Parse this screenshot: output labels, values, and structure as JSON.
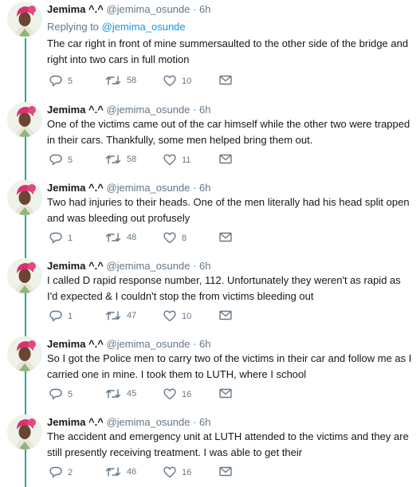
{
  "tweets": [
    {
      "name": "Jemima ^.^",
      "handle": "@jemima_osunde",
      "dot": "·",
      "time": "6h",
      "replying_prefix": "Replying to ",
      "replying_to": "@jemima_osunde",
      "text": "The car right in front of mine summersaulted to the other side of the bridge and right into two cars in full motion",
      "replies": "5",
      "retweets": "58",
      "likes": "10"
    },
    {
      "name": "Jemima ^.^",
      "handle": "@jemima_osunde",
      "dot": "·",
      "time": "6h",
      "text": "One of the victims came out of the car himself while the other two were trapped in their cars. Thankfully, some men helped bring them out.",
      "replies": "5",
      "retweets": "58",
      "likes": "11"
    },
    {
      "name": "Jemima ^.^",
      "handle": "@jemima_osunde",
      "dot": "·",
      "time": "6h",
      "text": "Two had injuries to their heads. One of the men literally had his head split open and was bleeding out profusely",
      "replies": "1",
      "retweets": "48",
      "likes": "8"
    },
    {
      "name": "Jemima ^.^",
      "handle": "@jemima_osunde",
      "dot": "·",
      "time": "6h",
      "text": "I called D rapid response number, 112. Unfortunately they weren't as rapid as I'd expected & I couldn't stop the from victims bleeding out",
      "replies": "1",
      "retweets": "47",
      "likes": "10"
    },
    {
      "name": "Jemima ^.^",
      "handle": "@jemima_osunde",
      "dot": "·",
      "time": "6h",
      "text": "So I got the Police men to carry two of the victims in their car and follow me as I carried one in mine. I took them to LUTH, where I school",
      "replies": "5",
      "retweets": "45",
      "likes": "16"
    },
    {
      "name": "Jemima ^.^",
      "handle": "@jemima_osunde",
      "dot": "·",
      "time": "6h",
      "text": "The accident and emergency unit at LUTH attended to the victims and they are still presently receiving treatment. I was able to get their",
      "replies": "2",
      "retweets": "46",
      "likes": "16"
    }
  ],
  "colors": {
    "thread_line": "#2aa3a8",
    "link": "#1b95e0",
    "secondary_text": "#657786",
    "avatar_headwrap": "#d9336f"
  },
  "icons": {
    "reply": "reply-icon",
    "retweet": "retweet-icon",
    "like": "heart-icon",
    "dm": "envelope-icon"
  }
}
